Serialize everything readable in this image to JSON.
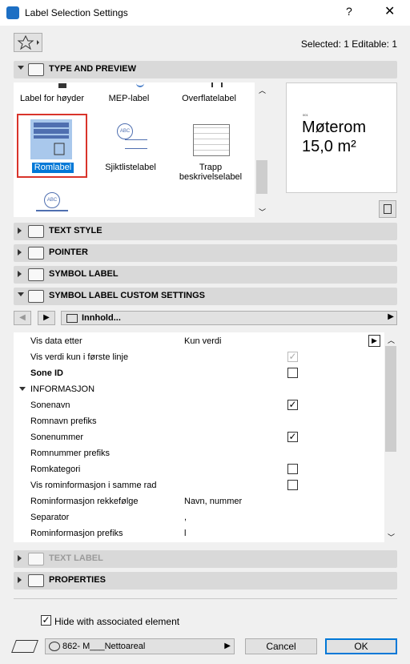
{
  "window": {
    "title": "Label Selection Settings",
    "help": "?",
    "close": "✕"
  },
  "selection_info": "Selected: 1 Editable: 1",
  "sections": {
    "type_preview": "TYPE AND PREVIEW",
    "text_style": "TEXT STYLE",
    "pointer": "POINTER",
    "symbol_label": "SYMBOL LABEL",
    "custom": "SYMBOL LABEL CUSTOM SETTINGS",
    "text_label": "TEXT LABEL",
    "properties": "PROPERTIES"
  },
  "gallery": {
    "items": [
      {
        "label": "Label for høyder",
        "selected": false
      },
      {
        "label": "MEP-label",
        "selected": false
      },
      {
        "label": "Overflatelabel",
        "selected": false
      },
      {
        "label": "Romlabel",
        "selected": true
      },
      {
        "label": "Sjiktlistelabel",
        "selected": false
      },
      {
        "label": "Trapp beskrivelselabel",
        "selected": false
      }
    ]
  },
  "preview": {
    "small": "001",
    "line1": "Møterom",
    "line2": "15,0 m²"
  },
  "nav": {
    "prev": "◀",
    "next": "▶",
    "page": "Innhold..."
  },
  "params": [
    {
      "name": "Vis data etter",
      "value": "Kun verdi",
      "type": "text",
      "state": "selected"
    },
    {
      "name": "Vis verdi kun i første linje",
      "type": "check",
      "checked": true,
      "state": "disabled"
    },
    {
      "name": "Sone ID",
      "type": "check",
      "checked": false,
      "state": "bold"
    },
    {
      "name": "INFORMASJON",
      "type": "group",
      "state": "group"
    },
    {
      "name": "Sonenavn",
      "type": "check",
      "checked": true,
      "state": ""
    },
    {
      "name": "Romnavn prefiks",
      "type": "none",
      "state": ""
    },
    {
      "name": "Sonenummer",
      "type": "check",
      "checked": true,
      "state": ""
    },
    {
      "name": "Romnummer prefiks",
      "type": "none",
      "state": ""
    },
    {
      "name": "Romkategori",
      "type": "check",
      "checked": false,
      "state": ""
    },
    {
      "name": "Vis rominformasjon i samme rad",
      "type": "check",
      "checked": false,
      "state": ""
    },
    {
      "name": "Rominformasjon rekkefølge",
      "value": "Navn, nummer",
      "type": "text",
      "state": "disabled"
    },
    {
      "name": "Separator",
      "value": ",",
      "type": "text",
      "state": "disabled"
    },
    {
      "name": "Rominformasjon prefiks",
      "value": "l",
      "type": "text",
      "state": "disabled"
    }
  ],
  "footer": {
    "hide_label": "Hide with associated element",
    "hide_checked": true,
    "layer": "862- M___Nettoareal",
    "cancel": "Cancel",
    "ok": "OK"
  },
  "colors": {
    "accent": "#0078d7",
    "selection_border": "#d9342b",
    "header": "#d9d9d9"
  }
}
